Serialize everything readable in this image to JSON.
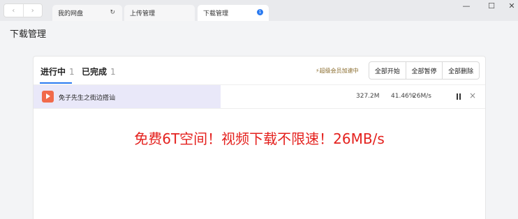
{
  "titlebar": {
    "nav_back": "‹",
    "nav_forward": "›",
    "tabs": [
      {
        "label": "我的网盘",
        "right_icon": "↻"
      },
      {
        "label": "上传管理"
      },
      {
        "label": "下载管理",
        "badge": "1"
      }
    ],
    "win_minimize": "—",
    "win_maximize": "☐",
    "win_close": "✕"
  },
  "page": {
    "title": "下载管理"
  },
  "filter_tabs": [
    {
      "label": "进行中",
      "count": "1"
    },
    {
      "label": "已完成",
      "count": "1"
    }
  ],
  "vip_hint": "超级会员加速中",
  "actions": {
    "start_all": "全部开始",
    "pause_all": "全部暂停",
    "delete_all": "全部删除"
  },
  "downloads": [
    {
      "name": "免子先生之街边搭讪",
      "size": "327.2M",
      "percent": "41.46%",
      "speed": "26M/s",
      "progress": 0.4146
    }
  ],
  "promo_text": "免费6T空间！视频下载不限速！26MB/s",
  "colors": {
    "accent": "#2a7af0",
    "promo": "#e4211e",
    "progress_fill": "#e9e8f9",
    "file_icon": "#f16a4b"
  }
}
